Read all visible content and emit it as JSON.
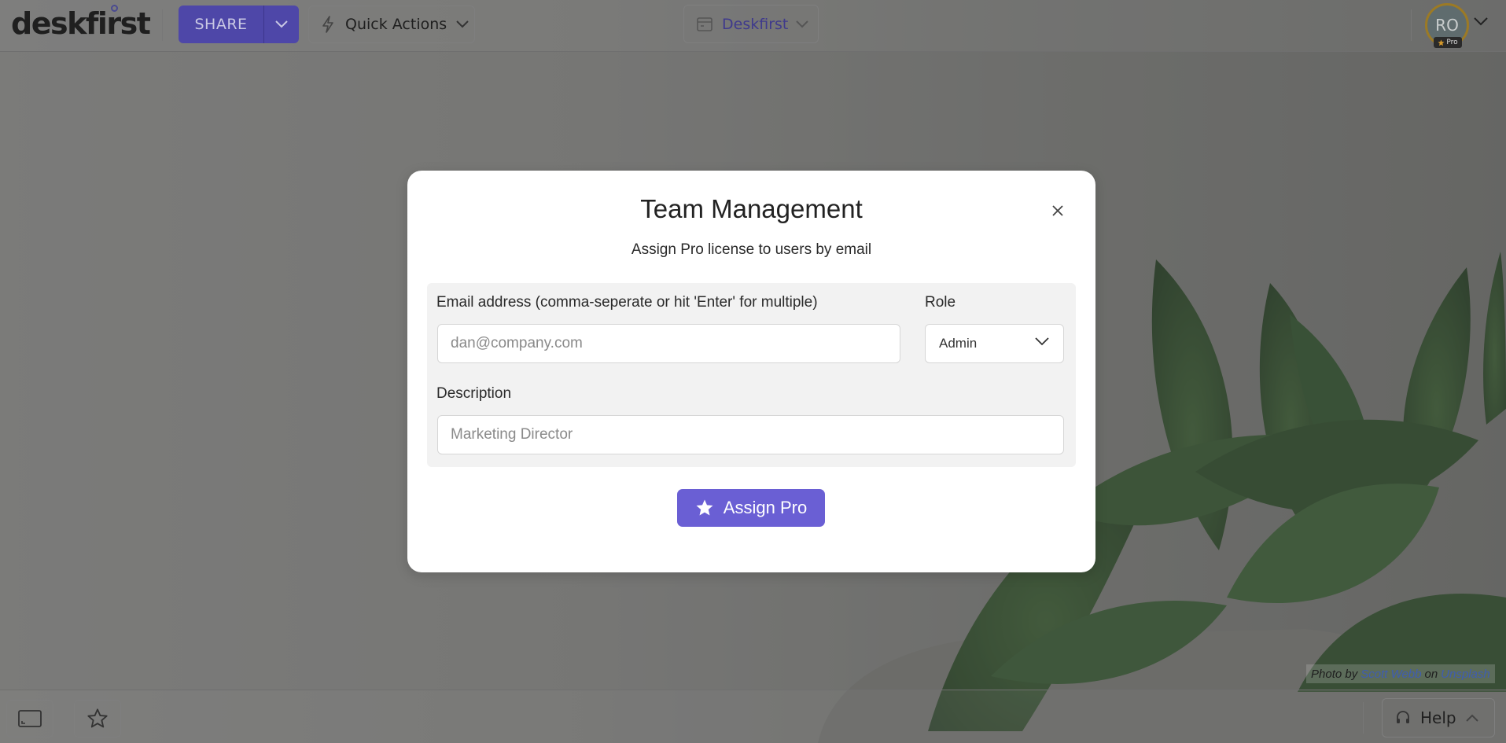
{
  "app": {
    "logo_text": "deskfirst"
  },
  "topbar": {
    "share_label": "SHARE",
    "quick_actions_label": "Quick Actions",
    "workspace_label": "Deskfirst",
    "avatar_initials": "RO",
    "avatar_badge": "Pro"
  },
  "modal": {
    "title": "Team Management",
    "subtitle": "Assign Pro license to users by email",
    "email_label": "Email address (comma-seperate or hit 'Enter' for multiple)",
    "email_placeholder": "dan@company.com",
    "role_label": "Role",
    "role_value": "Admin",
    "description_label": "Description",
    "description_placeholder": "Marketing Director",
    "assign_button": "Assign Pro"
  },
  "credit": {
    "prefix": "Photo by",
    "author": "Scott Webb",
    "on": "on",
    "source": "Unsplash"
  },
  "bottombar": {
    "help_label": "Help"
  },
  "colors": {
    "accent": "#6a5fd4",
    "share_bg": "#4e47a8",
    "workspace_text": "#3f3a8c"
  }
}
